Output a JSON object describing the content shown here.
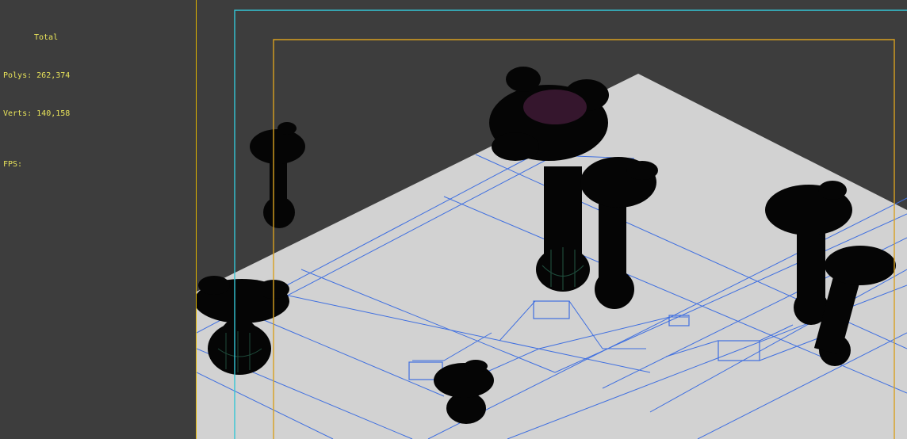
{
  "stats": {
    "title": "Total",
    "polys_label": "Polys:",
    "polys_value": "262,374",
    "verts_label": "Verts:",
    "verts_value": "140,158",
    "fps_label": "FPS:",
    "fps_value": ""
  },
  "colors": {
    "background": "#3d3d3d",
    "stats_text": "#e8e35a",
    "viewport_border": "#e0b400",
    "safe_frame_outer": "#34c6d6",
    "safe_frame_inner": "#d8a020",
    "ground": "#d2d2d2",
    "grid_lines": "#3f6fe0",
    "plants": "#050505",
    "vase_green": "#1e4a3a",
    "palm_top": "#4a1e3e"
  },
  "scene": {
    "objects": [
      "ground-plane",
      "potted-plant",
      "potted-plant",
      "potted-plant",
      "potted-plant",
      "potted-plant",
      "potted-plant",
      "potted-plant"
    ]
  }
}
